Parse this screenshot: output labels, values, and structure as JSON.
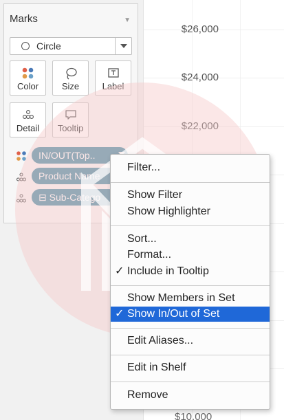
{
  "marks_card": {
    "title": "Marks",
    "mark_type": "Circle",
    "buttons": [
      {
        "label": "Color",
        "icon": "color-dots-icon"
      },
      {
        "label": "Size",
        "icon": "size-lasso-icon"
      },
      {
        "label": "Label",
        "icon": "label-text-icon"
      },
      {
        "label": "Detail",
        "icon": "detail-dots-icon"
      },
      {
        "label": "Tooltip",
        "icon": "tooltip-bubble-icon"
      }
    ],
    "pills": [
      {
        "label": "IN/OUT(Top..",
        "icon": "color-dots-icon"
      },
      {
        "label": "Product Name",
        "icon": "detail-dots-icon"
      },
      {
        "label": "⊟ Sub-Catego",
        "icon": "detail-dots-icon"
      }
    ]
  },
  "axis": {
    "ticks": [
      "$26,000",
      "$24,000",
      "$22,000"
    ],
    "bottom_tick": "$10,000"
  },
  "context_menu": {
    "items": [
      {
        "label": "Filter..."
      },
      {
        "label": "Show Filter"
      },
      {
        "label": "Show Highlighter"
      },
      {
        "label": "Sort..."
      },
      {
        "label": "Format..."
      },
      {
        "label": "Include in Tooltip",
        "checked": "✓"
      },
      {
        "label": "Show Members in Set"
      },
      {
        "label": "Show In/Out of Set",
        "checked": "✓"
      },
      {
        "label": "Edit Aliases..."
      },
      {
        "label": "Edit in Shelf"
      },
      {
        "label": "Remove"
      }
    ]
  },
  "colors": {
    "pill": "#4a90a8",
    "selection": "#1f68d8",
    "watermark": "#f6c9c9"
  }
}
